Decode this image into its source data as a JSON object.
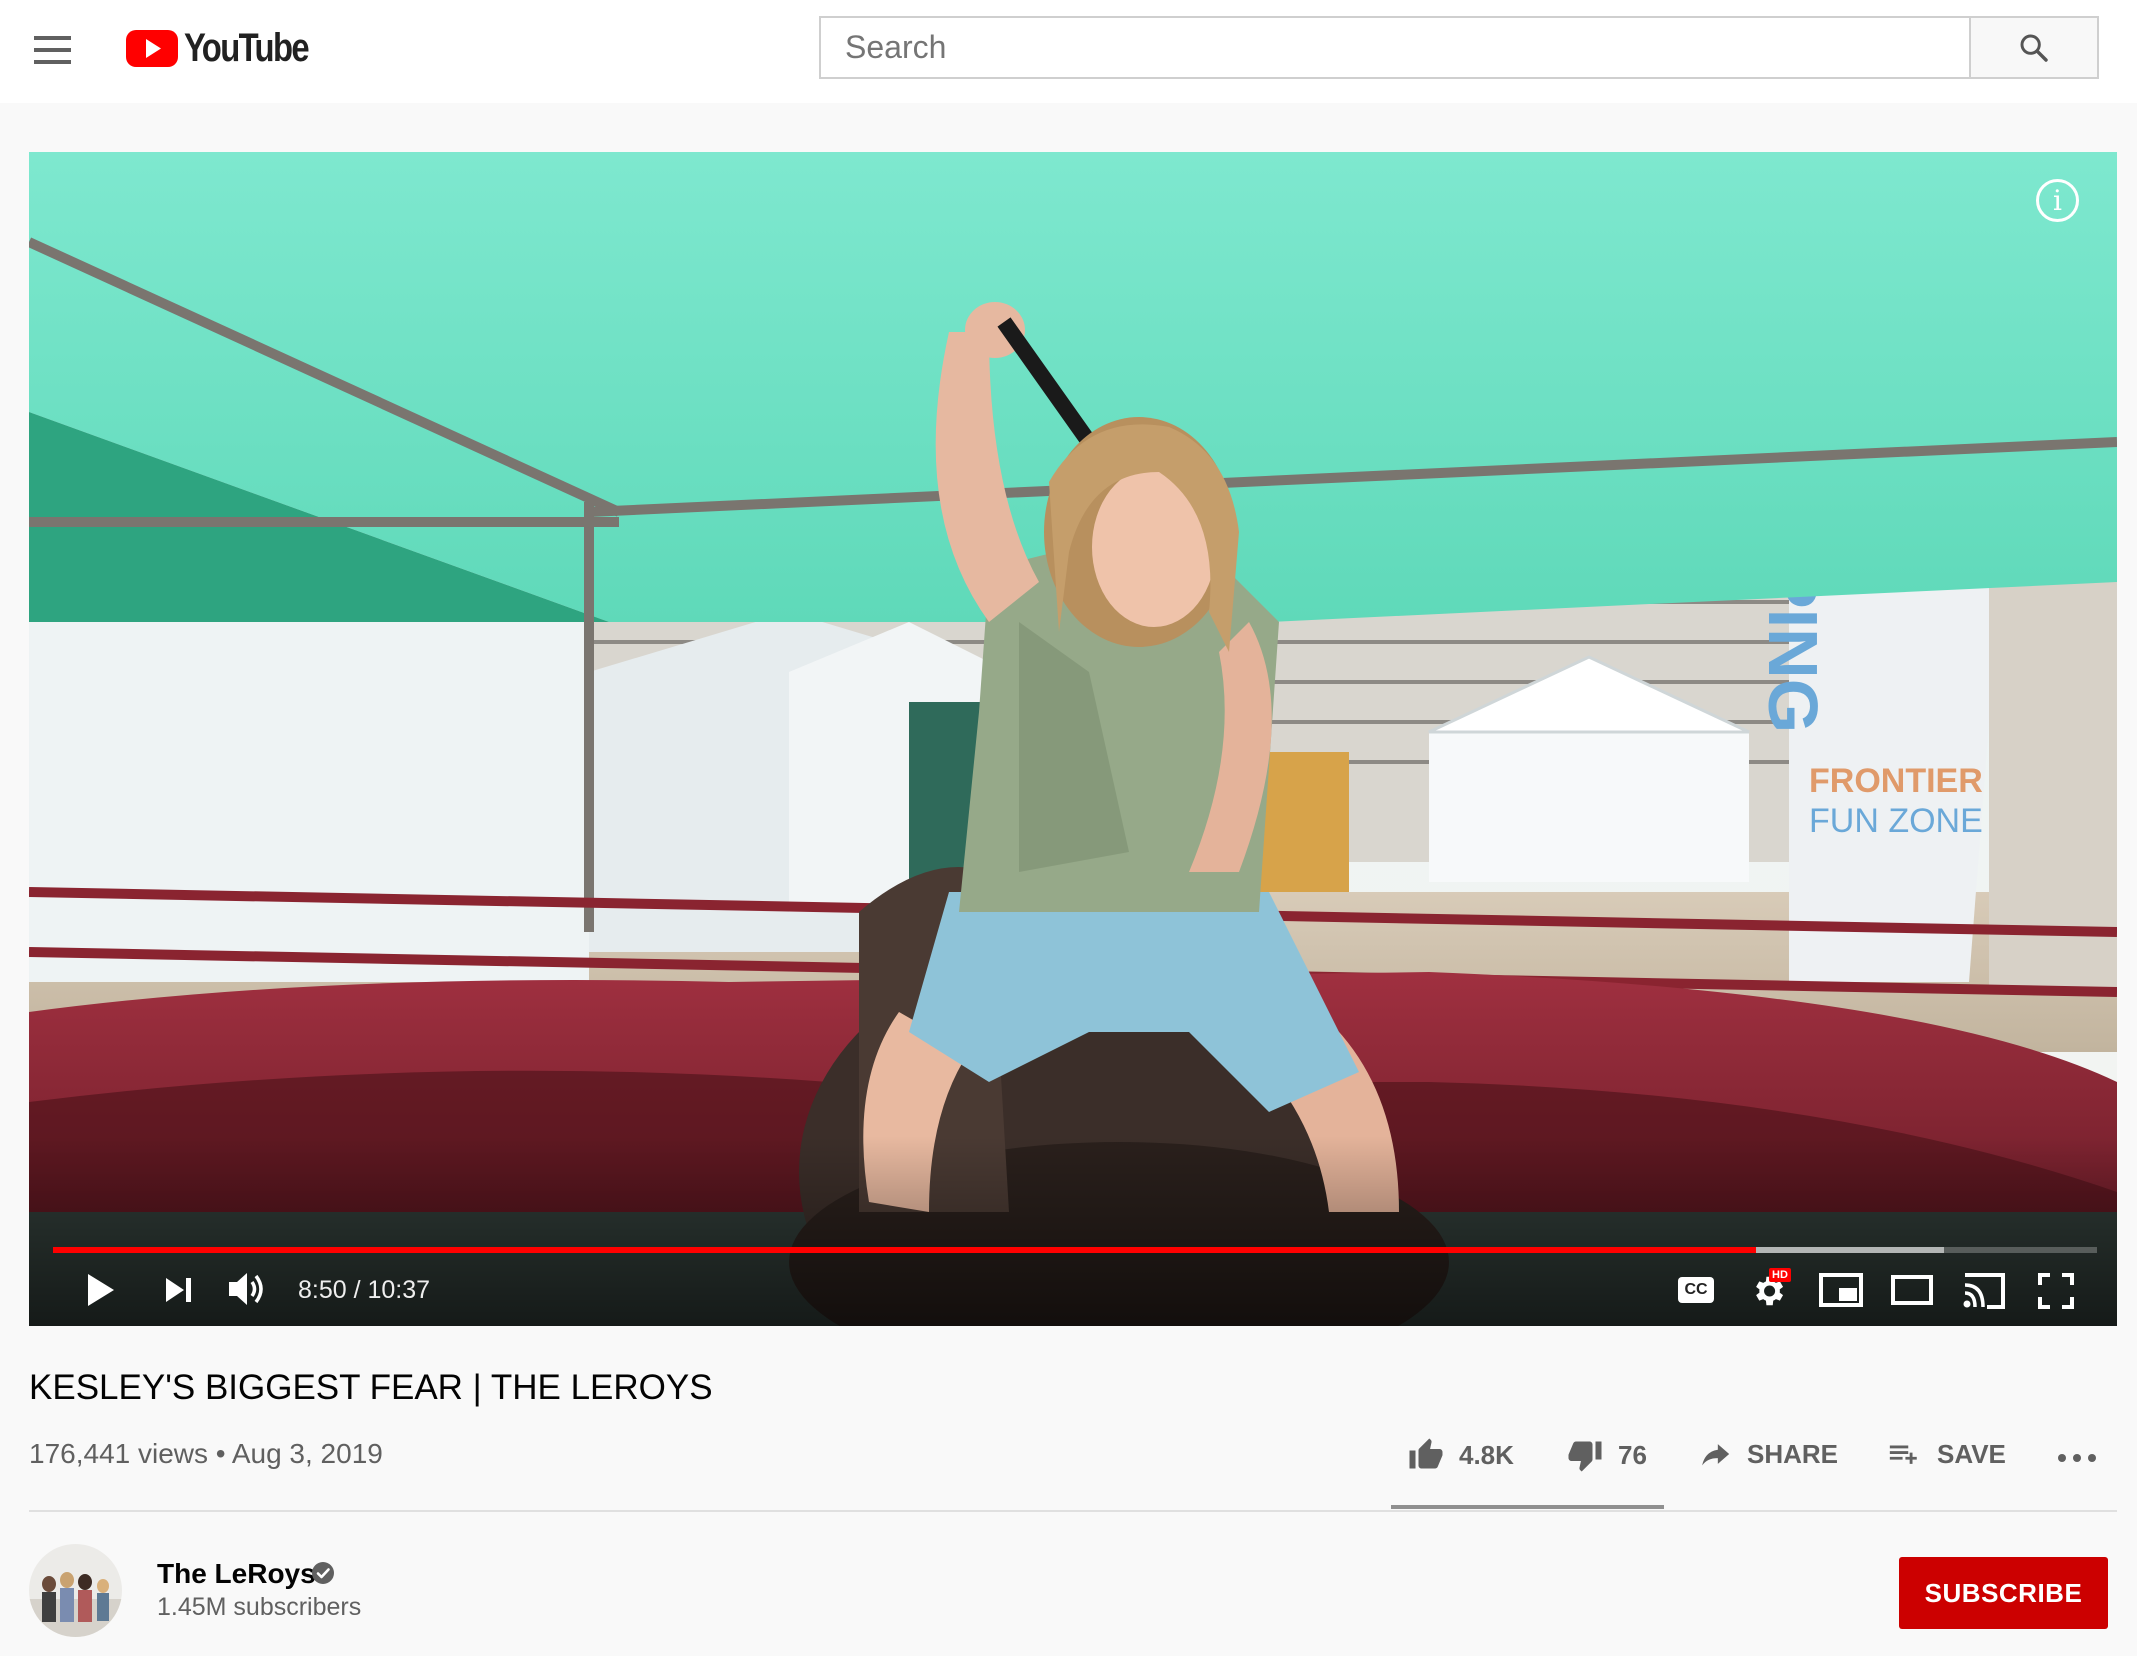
{
  "header": {
    "logo_text": "YouTube",
    "search_placeholder": "Search"
  },
  "player": {
    "current_time": "8:50",
    "duration": "10:37",
    "time_display": "8:50 / 10:37",
    "progress_fraction": 0.833,
    "buffered_fraction": 0.925,
    "hd_badge": "HD",
    "cc_label": "CC",
    "info_label": "i"
  },
  "video": {
    "title": "KESLEY'S BIGGEST FEAR | THE LEROYS",
    "views_date": "176,441 views • Aug 3, 2019",
    "likes": "4.8K",
    "dislikes": "76",
    "share_label": "SHARE",
    "save_label": "SAVE",
    "like_fraction": 0.98
  },
  "channel": {
    "name": "The LeRoys",
    "subscribers": "1.45M subscribers",
    "subscribe_label": "SUBSCRIBE"
  },
  "colors": {
    "brand_red": "#ff0000",
    "subscribe_red": "#cc0000",
    "secondary_text": "#606060"
  }
}
